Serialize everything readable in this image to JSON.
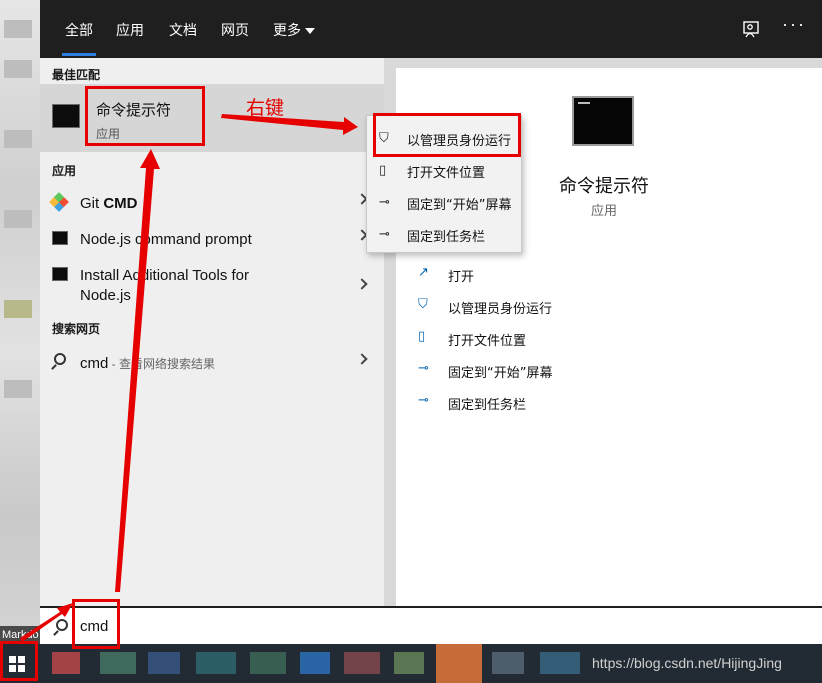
{
  "tabs": [
    "全部",
    "应用",
    "文档",
    "网页",
    "更多"
  ],
  "left": {
    "best_match_label": "最佳匹配",
    "best_match": {
      "title": "命令提示符",
      "subtitle": "应用"
    },
    "apps_label": "应用",
    "apps": [
      {
        "name_prefix": "Git ",
        "name_bold": "CMD",
        "icon": "git-icon"
      },
      {
        "name": "Node.js command prompt",
        "icon": "terminal-icon"
      },
      {
        "name_line1": "Install Additional Tools for",
        "name_line2": "Node.js",
        "icon": "terminal-icon"
      }
    ],
    "web_label": "搜索网页",
    "web_result": {
      "query": "cmd",
      "suffix": " - 查看网络搜索结果"
    }
  },
  "context_menu": [
    {
      "label": "以管理员身份运行",
      "icon": "shield-icon"
    },
    {
      "label": "打开文件位置",
      "icon": "file-location-icon"
    },
    {
      "label": "固定到“开始”屏幕",
      "icon": "pin-icon"
    },
    {
      "label": "固定到任务栏",
      "icon": "pin-icon"
    }
  ],
  "detail": {
    "title": "命令提示符",
    "subtitle": "应用",
    "actions": [
      {
        "label": "打开",
        "icon": "open-icon"
      },
      {
        "label": "以管理员身份运行",
        "icon": "shield-icon"
      },
      {
        "label": "打开文件位置",
        "icon": "file-location-icon"
      },
      {
        "label": "固定到“开始”屏幕",
        "icon": "pin-icon"
      },
      {
        "label": "固定到任务栏",
        "icon": "pin-icon"
      }
    ]
  },
  "search": {
    "value": "cmd"
  },
  "annotation": {
    "right_click_label": "右键"
  },
  "taskbar": {
    "partial_app_label": "Markdo",
    "watermark": "https://blog.csdn.net/HijingJing"
  },
  "colors": {
    "accent": "#2b7de0",
    "annotation_red": "#e60000",
    "topbar": "#1f1f1f",
    "taskbar": "#222a33"
  }
}
